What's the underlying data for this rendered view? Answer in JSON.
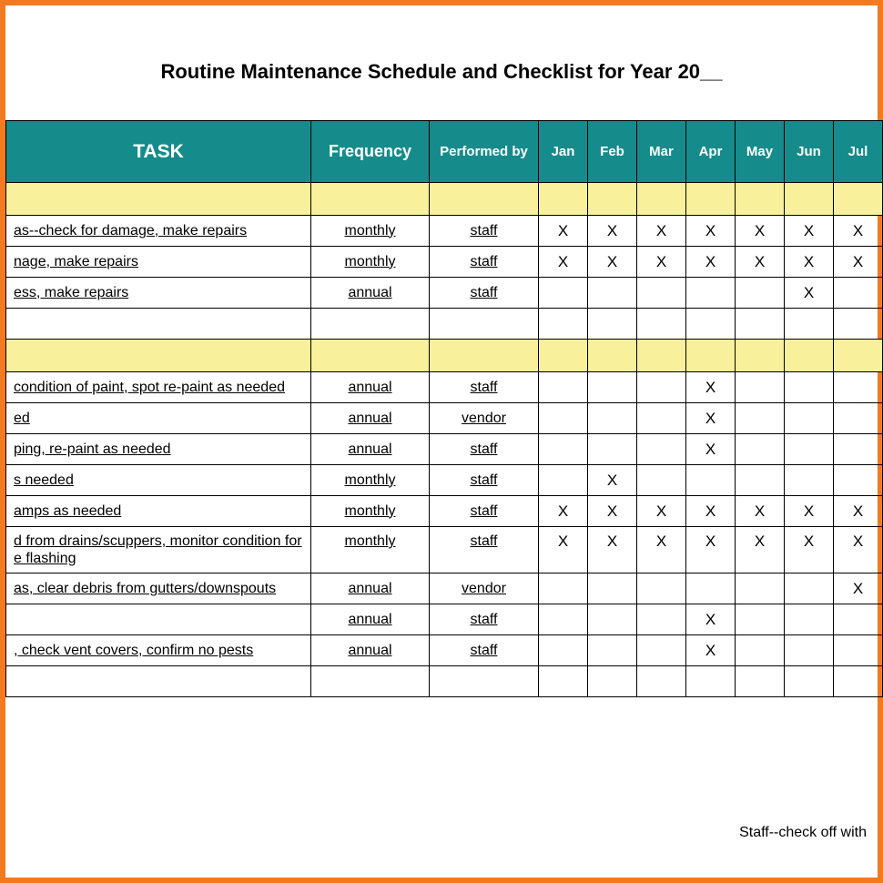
{
  "title": "Routine Maintenance Schedule and Checklist for Year 20__",
  "headers": {
    "task": "TASK",
    "frequency": "Frequency",
    "performed_by": "Performed by",
    "months": [
      "Jan",
      "Feb",
      "Mar",
      "Apr",
      "May",
      "Jun",
      "Jul"
    ]
  },
  "section1": [
    {
      "task": "as--check for damage, make repairs",
      "freq": "monthly",
      "perf": "staff",
      "m": [
        "X",
        "X",
        "X",
        "X",
        "X",
        "X",
        "X"
      ]
    },
    {
      "task": "nage, make repairs",
      "freq": "monthly",
      "perf": "staff",
      "m": [
        "X",
        "X",
        "X",
        "X",
        "X",
        "X",
        "X"
      ]
    },
    {
      "task": "ess, make repairs",
      "freq": "annual",
      "perf": "staff",
      "m": [
        "",
        "",
        "",
        "",
        "",
        "X",
        ""
      ]
    },
    {
      "task": "",
      "freq": "",
      "perf": "",
      "m": [
        "",
        "",
        "",
        "",
        "",
        "",
        ""
      ]
    }
  ],
  "section2": [
    {
      "task": "condition of paint, spot re-paint as needed",
      "freq": "annual",
      "perf": "staff",
      "m": [
        "",
        "",
        "",
        "X",
        "",
        "",
        ""
      ]
    },
    {
      "task": "ed",
      "freq": "annual",
      "perf": "vendor",
      "m": [
        "",
        "",
        "",
        "X",
        "",
        "",
        ""
      ]
    },
    {
      "task": "ping, re-paint as needed",
      "freq": "annual",
      "perf": "staff",
      "m": [
        "",
        "",
        "",
        "X",
        "",
        "",
        ""
      ]
    },
    {
      "task": "s needed",
      "freq": "monthly",
      "perf": "staff",
      "m": [
        "",
        "X",
        "",
        "",
        "",
        "",
        ""
      ]
    },
    {
      "task": "amps as needed",
      "freq": "monthly",
      "perf": "staff",
      "m": [
        "X",
        "X",
        "X",
        "X",
        "X",
        "X",
        "X"
      ]
    },
    {
      "task": "d from drains/scuppers, monitor condition for e flashing",
      "freq": "monthly",
      "perf": "staff",
      "m": [
        "X",
        "X",
        "X",
        "X",
        "X",
        "X",
        "X"
      ],
      "tall": true
    },
    {
      "task": "as, clear debris from gutters/downspouts",
      "freq": "annual",
      "perf": "vendor",
      "m": [
        "",
        "",
        "",
        "",
        "",
        "",
        "X"
      ]
    },
    {
      "task": "",
      "freq": "annual",
      "perf": "staff",
      "m": [
        "",
        "",
        "",
        "X",
        "",
        "",
        ""
      ]
    },
    {
      "task": ", check vent covers, confirm no pests",
      "freq": "annual",
      "perf": "staff",
      "m": [
        "",
        "",
        "",
        "X",
        "",
        "",
        ""
      ]
    },
    {
      "task": "",
      "freq": "",
      "perf": "",
      "m": [
        "",
        "",
        "",
        "",
        "",
        "",
        ""
      ]
    }
  ],
  "footnote": "Staff--check off with",
  "mark": "X"
}
